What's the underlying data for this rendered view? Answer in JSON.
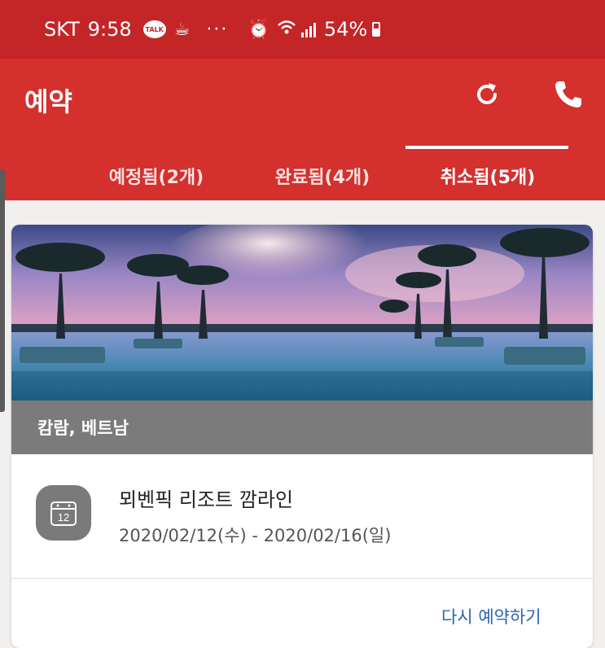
{
  "status_bar": {
    "carrier": "SKT",
    "time": "9:58",
    "talk_badge": "TALK",
    "overflow": "···",
    "battery": "54%",
    "icons": [
      "talk-icon",
      "coffee-icon",
      "alarm-icon",
      "wifi-icon",
      "signal-icon",
      "battery-icon"
    ]
  },
  "app_bar": {
    "title": "예약",
    "background": "#d3302e",
    "icons": [
      "refresh-icon",
      "phone-icon"
    ]
  },
  "tabs": [
    {
      "label": "예정됨(2개)",
      "active": false
    },
    {
      "label": "완료됨(4개)",
      "active": false
    },
    {
      "label": "취소됨(5개)",
      "active": true
    }
  ],
  "booking": {
    "location": "캄람, 베트남",
    "hotel": "뫼벤픽 리조트 깜라인",
    "dates": "2020/02/12(수) - 2020/02/16(일)",
    "calendar_day": "12",
    "rebook_label": "다시 예약하기",
    "link_color": "#2d65b0"
  }
}
